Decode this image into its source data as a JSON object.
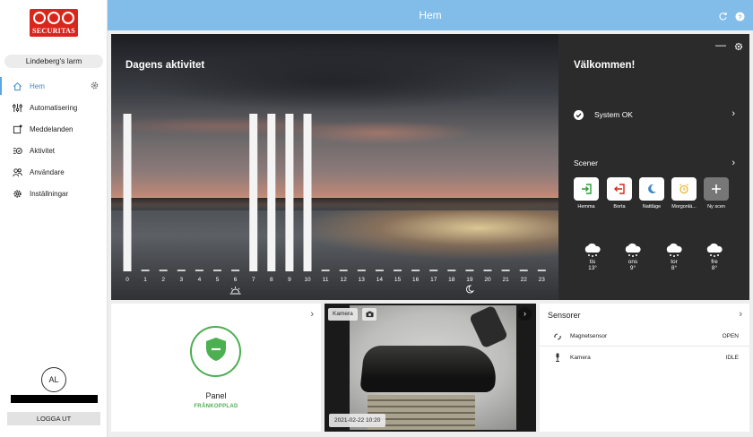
{
  "brand": {
    "logo_text": "SECURITAS"
  },
  "sidebar": {
    "account_name": "Lindeberg's larm",
    "items": [
      {
        "label": "Hem",
        "icon": "home-icon"
      },
      {
        "label": "Automatisering",
        "icon": "sliders-icon"
      },
      {
        "label": "Meddelanden",
        "icon": "message-icon"
      },
      {
        "label": "Aktivitet",
        "icon": "activity-list-icon"
      },
      {
        "label": "Användare",
        "icon": "users-icon"
      },
      {
        "label": "Inställningar",
        "icon": "gear-icon"
      }
    ],
    "avatar_initials": "AL",
    "logout_label": "LOGGA UT"
  },
  "header": {
    "title": "Hem"
  },
  "activity": {
    "title": "Dagens aktivitet",
    "sunrise_icon": "sunrise-icon",
    "moon_icon": "moon-icon"
  },
  "chart_data": {
    "type": "bar",
    "categories": [
      "0",
      "1",
      "2",
      "3",
      "4",
      "5",
      "6",
      "7",
      "8",
      "9",
      "10",
      "11",
      "12",
      "13",
      "14",
      "15",
      "16",
      "17",
      "18",
      "19",
      "20",
      "21",
      "22",
      "23"
    ],
    "values": [
      1,
      0,
      0,
      0,
      0,
      0,
      0,
      1,
      1,
      1,
      1,
      0,
      0,
      0,
      0,
      0,
      0,
      0,
      0,
      0,
      0,
      0,
      0,
      0
    ],
    "ylim": [
      0,
      1
    ],
    "grid": false
  },
  "welcome": {
    "title": "Välkommen!",
    "system_status": "System OK",
    "scenes_title": "Scener",
    "scenes": [
      {
        "label": "Hemma",
        "icon": "home-arrow-icon",
        "color": "#2e9b3a"
      },
      {
        "label": "Borta",
        "icon": "away-arrow-icon",
        "color": "#d9261c"
      },
      {
        "label": "Nattläge",
        "icon": "moon-icon",
        "color": "#3d87c9"
      },
      {
        "label": "Morgonlä...",
        "icon": "alarm-clock-icon",
        "color": "#e8b730"
      },
      {
        "label": "Ny scen",
        "icon": "plus-icon",
        "color": "#ffffff"
      }
    ],
    "forecast": [
      {
        "day": "tis",
        "temp": "13°",
        "icon": "snow-cloud-icon"
      },
      {
        "day": "ons",
        "temp": "9°",
        "icon": "snow-cloud-icon"
      },
      {
        "day": "tor",
        "temp": "8°",
        "icon": "snow-cloud-icon"
      },
      {
        "day": "fre",
        "temp": "8°",
        "icon": "snow-cloud-icon"
      }
    ]
  },
  "panel_card": {
    "label": "Panel",
    "status": "FRÅNKOPPLAD",
    "status_color": "#4caf50"
  },
  "camera_card": {
    "tag": "Kamera",
    "timestamp": "2021-02-22 10:20"
  },
  "sensors_card": {
    "title": "Sensorer",
    "sensors": [
      {
        "name": "Magnetsensor",
        "state": "OPEN",
        "icon": "magnet-sensor-icon"
      },
      {
        "name": "Kamera",
        "state": "IDLE",
        "icon": "camera-sensor-icon"
      }
    ]
  },
  "colors": {
    "header": "#82bce9",
    "accent": "#3d87c9",
    "brand": "#d9261c"
  }
}
